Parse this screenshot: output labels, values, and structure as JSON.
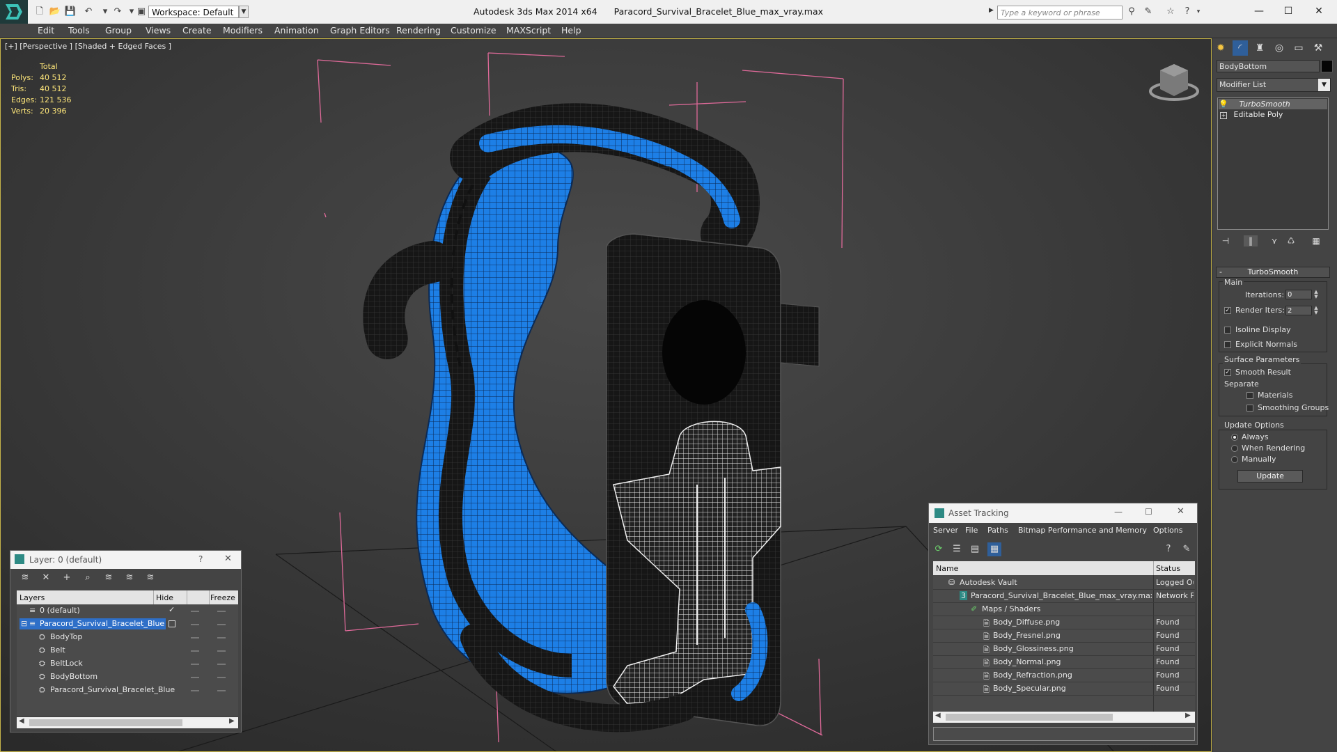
{
  "app": {
    "logo": "3ds Max logo",
    "title": "Autodesk 3ds Max  2014 x64",
    "file": "Paracord_Survival_Bracelet_Blue_max_vray.max",
    "workspace": "Workspace: Default",
    "search_placeholder": "Type a keyword or phrase",
    "window_controls": {
      "minimize": "—",
      "maximize": "☐",
      "close": "✕"
    }
  },
  "menu": [
    "Edit",
    "Tools",
    "Group",
    "Views",
    "Create",
    "Modifiers",
    "Animation",
    "Graph Editors",
    "Rendering",
    "Customize",
    "MAXScript",
    "Help"
  ],
  "viewport": {
    "label": "[+] [Perspective ] [Shaded + Edged Faces ]",
    "stats": {
      "header": "Total",
      "rows": [
        {
          "label": "Polys:",
          "value": "40 512"
        },
        {
          "label": "Tris:",
          "value": "40 512"
        },
        {
          "label": "Edges:",
          "value": "121 536"
        },
        {
          "label": "Verts:",
          "value": "20 396"
        }
      ]
    },
    "colors": {
      "blue_cord": "#1d7fe6",
      "black_cord": "#151515",
      "bounding_box": "#e06a9a",
      "grid": "#1a1a1a"
    }
  },
  "command_panel": {
    "object_name": "BodyBottom",
    "object_color": "#050505",
    "modifier_list": "Modifier List",
    "stack": [
      "TurboSmooth",
      "Editable Poly"
    ],
    "turbosmooth": {
      "title": "TurboSmooth",
      "main_label": "Main",
      "iterations_label": "Iterations:",
      "iterations": "0",
      "render_iters_label": "Render Iters:",
      "render_iters": "2",
      "render_iters_checked": true,
      "isoline_display": "Isoline Display",
      "explicit_normals": "Explicit Normals",
      "surface_params": "Surface Parameters",
      "smooth_result": "Smooth Result",
      "smooth_result_checked": true,
      "separate": "Separate",
      "materials": "Materials",
      "smoothing_groups": "Smoothing Groups",
      "update_options": "Update Options",
      "always": "Always",
      "when_rendering": "When Rendering",
      "manually": "Manually",
      "update_button": "Update"
    }
  },
  "layer_dialog": {
    "title": "Layer: 0 (default)",
    "help": "?",
    "close": "✕",
    "columns": [
      "Layers",
      "Hide",
      "Freeze"
    ],
    "rows": [
      {
        "name": "0 (default)",
        "level": 0,
        "selected": false
      },
      {
        "name": "Paracord_Survival_Bracelet_Blue",
        "level": 0,
        "selected": true
      },
      {
        "name": "BodyTop",
        "level": 1,
        "selected": false
      },
      {
        "name": "Belt",
        "level": 1,
        "selected": false
      },
      {
        "name": "BeltLock",
        "level": 1,
        "selected": false
      },
      {
        "name": "BodyBottom",
        "level": 1,
        "selected": false
      },
      {
        "name": "Paracord_Survival_Bracelet_Blue",
        "level": 1,
        "selected": false
      }
    ]
  },
  "asset_tracking": {
    "title": "Asset Tracking",
    "menu": [
      "Server",
      "File",
      "Paths",
      "Bitmap Performance and Memory",
      "Options"
    ],
    "columns": [
      "Name",
      "Status"
    ],
    "rows": [
      {
        "name": "Autodesk Vault",
        "status": "Logged Ou",
        "level": 0
      },
      {
        "name": "Paracord_Survival_Bracelet_Blue_max_vray.max",
        "status": "Network P",
        "level": 1
      },
      {
        "name": "Maps / Shaders",
        "status": "",
        "level": 2
      },
      {
        "name": "Body_Diffuse.png",
        "status": "Found",
        "level": 3
      },
      {
        "name": "Body_Fresnel.png",
        "status": "Found",
        "level": 3
      },
      {
        "name": "Body_Glossiness.png",
        "status": "Found",
        "level": 3
      },
      {
        "name": "Body_Normal.png",
        "status": "Found",
        "level": 3
      },
      {
        "name": "Body_Refraction.png",
        "status": "Found",
        "level": 3
      },
      {
        "name": "Body_Specular.png",
        "status": "Found",
        "level": 3
      }
    ]
  }
}
